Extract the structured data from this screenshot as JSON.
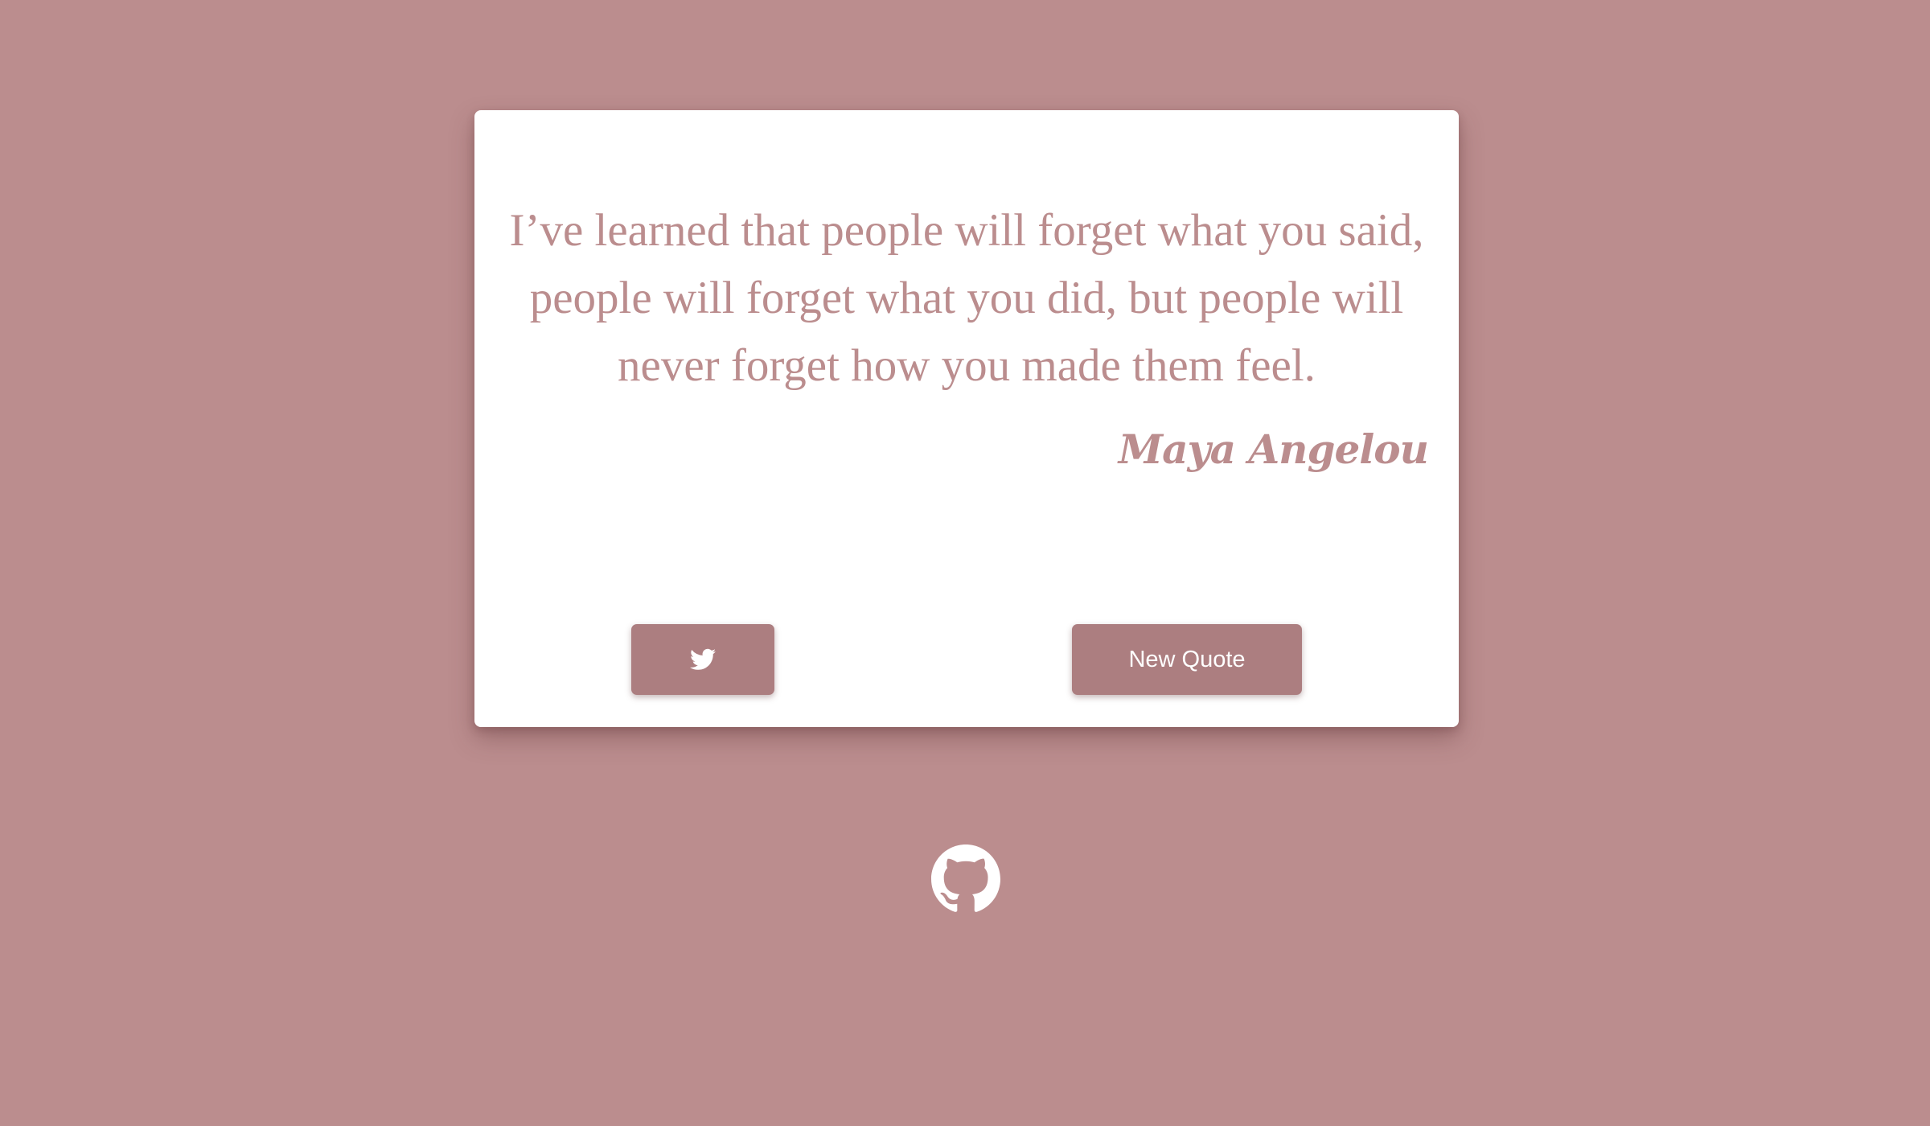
{
  "quote": {
    "text": "I’ve learned that people will forget what you said, people will forget what you did, but people will never forget how you made them feel.",
    "author": "Maya Angelou"
  },
  "buttons": {
    "tweet_icon": "twitter-icon",
    "new_quote_label": "New Quote"
  },
  "footer": {
    "github_icon": "github-icon"
  },
  "colors": {
    "background": "#bb8d8e",
    "card": "#ffffff",
    "accent": "#bb8d8e",
    "button": "#ac7e80",
    "button_text": "#ffffff"
  }
}
